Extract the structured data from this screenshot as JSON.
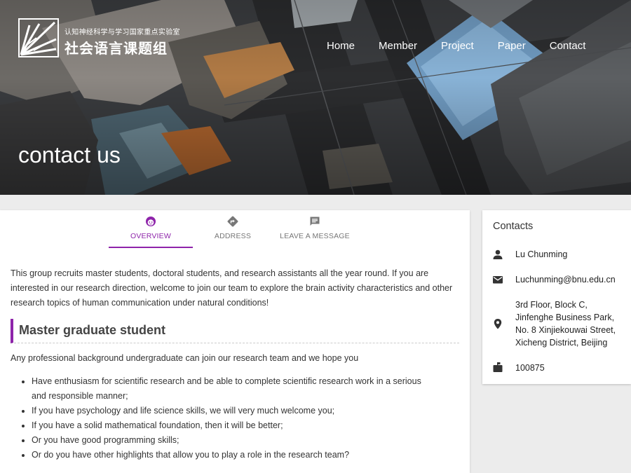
{
  "site": {
    "subtitle": "认知神经科学与学习国家重点实验室",
    "name": "社会语言课题组"
  },
  "nav": {
    "items": [
      "Home",
      "Member",
      "Project",
      "Paper",
      "Contact"
    ]
  },
  "hero": {
    "title": "contact us"
  },
  "tabs": {
    "items": [
      {
        "label": "OVERVIEW",
        "icon": "face-icon"
      },
      {
        "label": "ADDRESS",
        "icon": "directions-icon"
      },
      {
        "label": "LEAVE A MESSAGE",
        "icon": "message-icon"
      }
    ],
    "active": "OVERVIEW"
  },
  "content": {
    "intro": "This group recruits master students, doctoral students, and research assistants all the year round. If you are interested in our research direction, welcome to join our team to explore the brain activity characteristics and other research topics of human communication under natural conditions!",
    "section_title": "Master graduate student",
    "lead": "Any professional background undergraduate can join our research team and we hope you",
    "bullets": [
      "Have enthusiasm for scientific research and be able to complete scientific research work in a serious and responsible manner;",
      "If you have psychology and life science skills, we will very much welcome you;",
      "If you have a solid mathematical foundation, then it will be better;",
      "Or you have good programming skills;",
      "Or do you have other highlights that allow you to play a role in the research team?"
    ]
  },
  "contacts": {
    "title": "Contacts",
    "name": "Lu Chunming",
    "email": "Luchunming@bnu.edu.cn",
    "address_lines": [
      "3rd Floor, Block C,",
      "Jinfenghe Business Park,",
      "No. 8 Xinjiekouwai Street,",
      "Xicheng District, Beijing"
    ],
    "postcode": "100875"
  },
  "colors": {
    "accent": "#8e24aa",
    "text": "#333333",
    "page_bg": "#ececec"
  }
}
